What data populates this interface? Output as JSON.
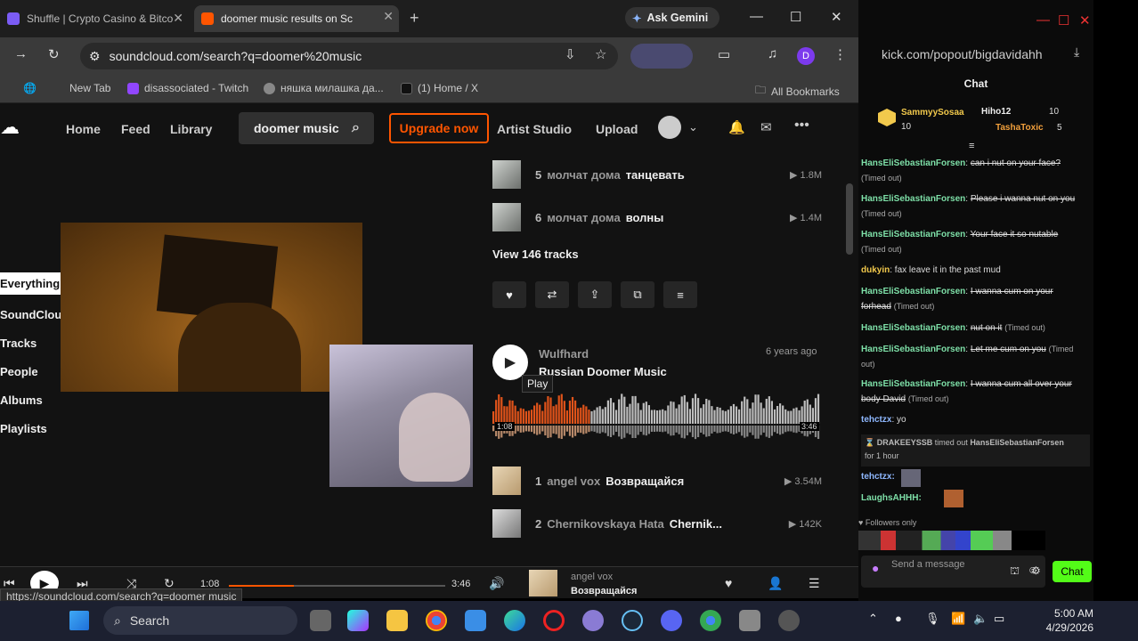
{
  "tabs": [
    {
      "title": "Shuffle | Crypto Casino & Bitco",
      "fav_color": "#7b5cf5"
    },
    {
      "title": "doomer music results on Sc",
      "fav_color": "#f50"
    }
  ],
  "gemini_label": "Ask Gemini",
  "address_bar": "soundcloud.com/search?q=doomer%20music",
  "profile_letter": "D",
  "bookmarks": [
    "New Tab",
    "disassociated - Twitch",
    "няшка милашка да...",
    "(1) Home / X",
    "All Bookmarks"
  ],
  "soundcloud": {
    "nav": [
      "Home",
      "Feed",
      "Library"
    ],
    "search_value": "doomer music",
    "upgrade": "Upgrade now",
    "artist_studio": "Artist Studio",
    "upload": "Upload",
    "filters": [
      "Everything",
      "SoundCloud",
      "Tracks",
      "People",
      "Albums",
      "Playlists"
    ],
    "playlist_tracks": [
      {
        "num": "5",
        "artist": "молчат дома",
        "title": "танцевать",
        "plays": "1.8M"
      },
      {
        "num": "6",
        "artist": "молчат дома",
        "title": "волны",
        "plays": "1.4M"
      }
    ],
    "view_tracks": "View 146 tracks",
    "result": {
      "user": "Wulfhard",
      "age": "6 years ago",
      "title": "Russian Doomer Music",
      "tooltip": "Play",
      "elapsed": "1:08",
      "duration": "3:46",
      "progress": 0.3
    },
    "result_tracks": [
      {
        "num": "1",
        "artist": "angel vox",
        "title": "Возвращайся",
        "plays": "3.54M"
      },
      {
        "num": "2",
        "artist": "Chernikovskaya Hata",
        "title": "Chernik...",
        "plays": "142K"
      }
    ],
    "player": {
      "elapsed": "1:08",
      "duration": "3:46",
      "artist": "angel vox",
      "title": "Возвращайся",
      "progress": 0.3
    },
    "status_url": "https://soundcloud.com/search?q=doomer music"
  },
  "kick": {
    "url": "kick.com/popout/bigdavidahh",
    "header": "Chat",
    "leaders": [
      {
        "name": "SammyySosaa",
        "count": "10"
      },
      {
        "name": "Hiho12",
        "count": "10"
      },
      {
        "name": "TashaToxic",
        "count": "5"
      }
    ],
    "messages": [
      {
        "user": "HansEliSebastianForsen",
        "text": "can i nut on your face?",
        "note": "(Timed out)",
        "color": "#7ee0a8"
      },
      {
        "user": "HansEliSebastianForsen",
        "text": "Please i wanna nut on you",
        "note": "(Timed out)",
        "color": "#7ee0a8"
      },
      {
        "user": "HansEliSebastianForsen",
        "text": "Your face it so nutable",
        "note": "(Timed out)",
        "color": "#7ee0a8"
      },
      {
        "user": "dukyin",
        "text": "fax leave it in the past mud",
        "note": "",
        "color": "#f2c94c"
      },
      {
        "user": "HansEliSebastianForsen",
        "text": "I wanna cum on your forhead",
        "note": "(Timed out)",
        "color": "#7ee0a8"
      },
      {
        "user": "HansEliSebastianForsen",
        "text": "nut on it",
        "note": "(Timed out)",
        "color": "#7ee0a8"
      },
      {
        "user": "HansEliSebastianForsen",
        "text": "Let me cum on you",
        "note": "(Timed out)",
        "color": "#7ee0a8"
      },
      {
        "user": "HansEliSebastianForsen",
        "text": "I wanna cum all over your body David",
        "note": "(Timed out)",
        "color": "#7ee0a8"
      },
      {
        "user": "tehctzx",
        "text": "yo",
        "note": "",
        "color": "#8fb8ff"
      }
    ],
    "mod_notice": {
      "mod": "DRAKEEYSSB",
      "action": "timed out",
      "target": "HansEliSebastianForsen",
      "duration": "for 1 hour"
    },
    "msg_emote1": "tehctzx:",
    "msg_emote2": "LaughsAHHH:",
    "followers_only": "Followers only",
    "input_placeholder": "Send a message",
    "send_label": "Chat"
  },
  "taskbar": {
    "search": "Search",
    "time": "5:00 AM",
    "date": "4/29/2026"
  }
}
